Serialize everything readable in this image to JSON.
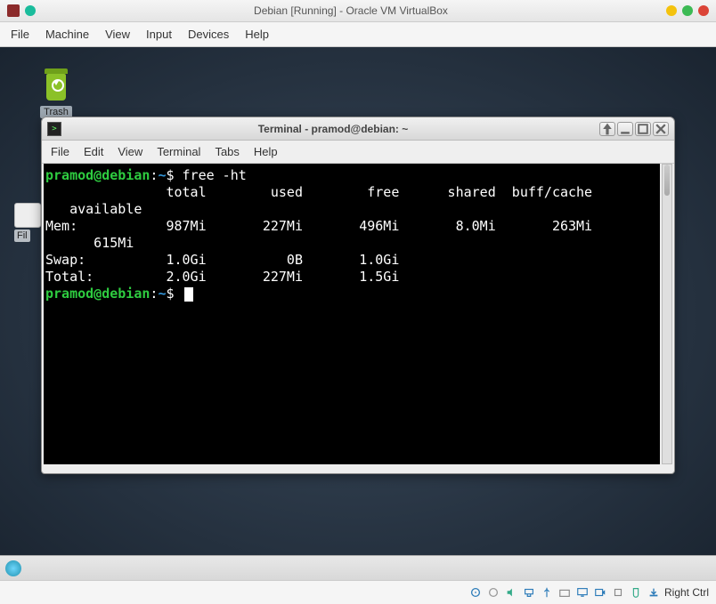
{
  "vbox": {
    "title": "Debian [Running] - Oracle VM VirtualBox",
    "menus": [
      "File",
      "Machine",
      "View",
      "Input",
      "Devices",
      "Help"
    ],
    "status_host_key": "Right Ctrl"
  },
  "desktop": {
    "trash_label": "Trash",
    "files_label": "Fil"
  },
  "terminal": {
    "title": "Terminal - pramod@debian: ~",
    "menus": [
      "File",
      "Edit",
      "View",
      "Terminal",
      "Tabs",
      "Help"
    ],
    "prompt_user": "pramod@debian",
    "prompt_path": "~",
    "command": "free -ht",
    "output_lines": [
      "               total        used        free      shared  buff/cache",
      "   available",
      "Mem:           987Mi       227Mi       496Mi       8.0Mi       263Mi",
      "      615Mi",
      "Swap:          1.0Gi          0B       1.0Gi",
      "Total:         2.0Gi       227Mi       1.5Gi"
    ]
  }
}
